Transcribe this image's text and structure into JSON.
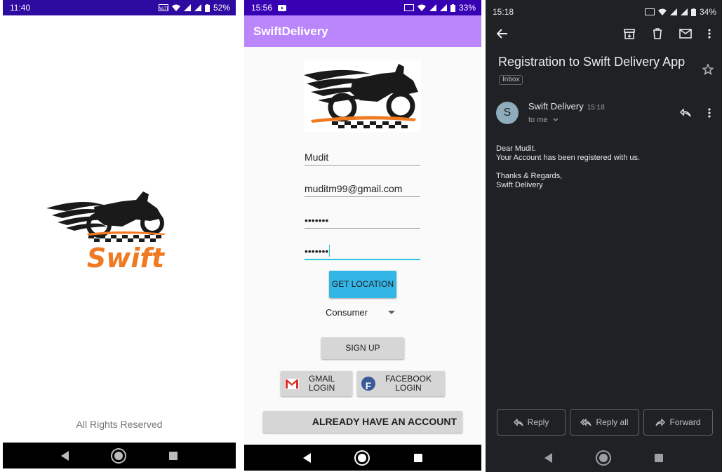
{
  "splash": {
    "status": {
      "time": "11:40",
      "battery": "52%"
    },
    "brand": "Swift",
    "footer": "All Rights Reserved"
  },
  "signup": {
    "status": {
      "time": "15:56",
      "battery": "33%"
    },
    "app_title": "SwiftDelivery",
    "fields": {
      "name": "Mudit",
      "email": "muditm99@gmail.com",
      "password": "•••••••",
      "confirm_password": "•••••••"
    },
    "get_location_label": "GET LOCATION",
    "role_selected": "Consumer",
    "sign_up_label": "SIGN UP",
    "gmail_label_1": "GMAIL",
    "gmail_label_2": "LOGIN",
    "facebook_label_1": "FACEBOOK",
    "facebook_label_2": "LOGIN",
    "already_label": "ALREADY HAVE AN ACCOUNT"
  },
  "email": {
    "status": {
      "time": "15:18",
      "battery": "34%"
    },
    "subject": "Registration to Swift Delivery App",
    "label": "Inbox",
    "avatar_letter": "S",
    "sender": "Swift Delivery",
    "time": "15:18",
    "to": "to me",
    "body": {
      "line1": "Dear Mudit.",
      "line2": "Your Account has been registered with us.",
      "line3": "Thanks & Regards,",
      "line4": "Swift Delivery"
    },
    "reply_label": "Reply",
    "reply_all_label": "Reply all",
    "forward_label": "Forward"
  },
  "colors": {
    "splash_status": "#2d0aa0",
    "form_status": "#3700b3",
    "appbar": "#bb86fc",
    "location_button": "#33b5e5",
    "brand_orange": "#f07a22",
    "email_bg": "#202124"
  }
}
